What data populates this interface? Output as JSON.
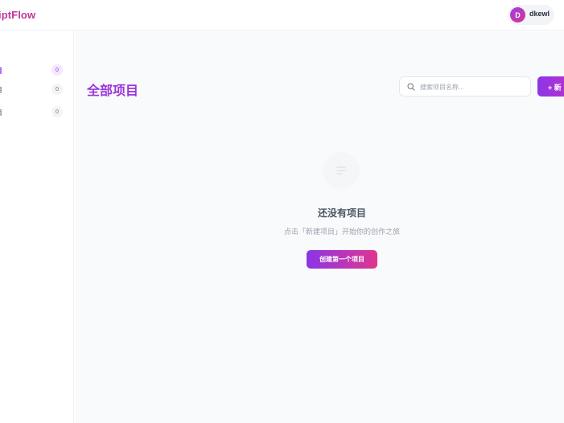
{
  "app": {
    "brand": "iptFlow"
  },
  "user": {
    "initial": "D",
    "name": "dkewl"
  },
  "sidebar": {
    "items": [
      {
        "label": "目",
        "count": "0",
        "active": true
      },
      {
        "label": "目",
        "count": "0",
        "active": false
      },
      {
        "label": "目",
        "count": "0",
        "active": false
      }
    ]
  },
  "main": {
    "title": "全部项目",
    "search_placeholder": "搜索项目名称...",
    "new_button_label": "+ 新",
    "empty": {
      "title": "还没有项目",
      "description": "点击「新建项目」开始你的创作之旅",
      "button_label": "创建第一个项目"
    }
  },
  "colors": {
    "accent": "#9b35d9",
    "brand": "#c0359a",
    "gradient_start": "#8b35e6",
    "gradient_end": "#e0368f"
  },
  "icons": {
    "search": "search-icon",
    "empty": "document-lines-icon"
  }
}
